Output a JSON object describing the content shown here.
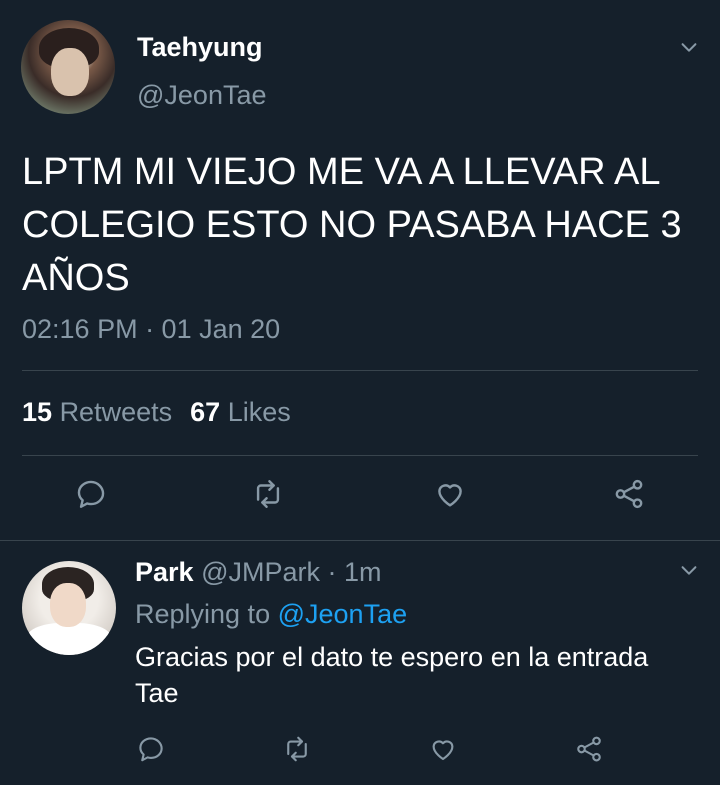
{
  "tweet": {
    "display_name": "Taehyung",
    "handle": "@JeonTae",
    "text": "LPTM MI VIEJO ME VA A LLEVAR AL COLEGIO ESTO NO PASABA HACE 3 AÑOS",
    "timestamp": "02:16 PM · 01 Jan 20",
    "retweets_count": "15",
    "retweets_label": "Retweets",
    "likes_count": "67",
    "likes_label": "Likes"
  },
  "reply": {
    "display_name": "Park",
    "handle": "@JMPark",
    "time": "· 1m",
    "replying_to_label": "Replying to",
    "replying_to_handle": "@JeonTae",
    "text": "Gracias por el dato te espero en la entrada Tae"
  },
  "colors": {
    "background": "#15202b",
    "secondary_text": "#8899a6",
    "accent": "#1da1f2",
    "divider": "#38444d"
  },
  "icons": [
    "chevron-down-icon",
    "reply-icon",
    "retweet-icon",
    "like-icon",
    "share-icon"
  ]
}
